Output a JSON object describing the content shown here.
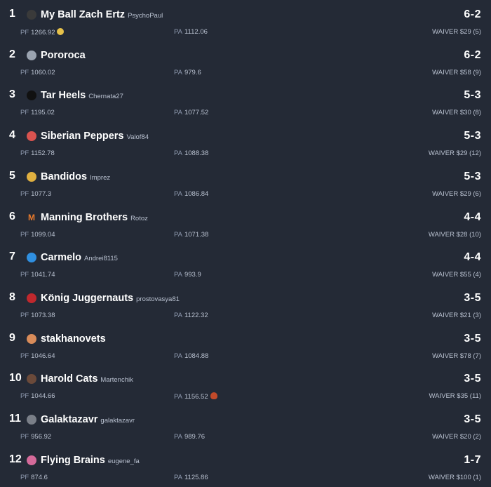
{
  "standings": [
    {
      "rank": "1",
      "team": "My Ball Zach Ertz",
      "owner": "PsychoPaul",
      "record": "6-2",
      "pf": "1266.92",
      "pa": "1112.06",
      "waiver": "WAIVER $29 (5)",
      "avatar_color": "#3a3a3a",
      "pf_emoji": "smiley-icon"
    },
    {
      "rank": "2",
      "team": "Pororoca",
      "owner": "",
      "record": "6-2",
      "pf": "1060.02",
      "pa": "979.6",
      "waiver": "WAIVER $58 (9)",
      "avatar_color": "#9aa3b0"
    },
    {
      "rank": "3",
      "team": "Tar Heels",
      "owner": "Chernata27",
      "record": "5-3",
      "pf": "1195.02",
      "pa": "1077.52",
      "waiver": "WAIVER $30 (8)",
      "avatar_color": "#111111"
    },
    {
      "rank": "4",
      "team": "Siberian Peppers",
      "owner": "Valof84",
      "record": "5-3",
      "pf": "1152.78",
      "pa": "1088.38",
      "waiver": "WAIVER $29 (12)",
      "avatar_color": "#d9534f"
    },
    {
      "rank": "5",
      "team": "Bandidos",
      "owner": "Imprez",
      "record": "5-3",
      "pf": "1077.3",
      "pa": "1086.84",
      "waiver": "WAIVER $29 (6)",
      "avatar_color": "#e0b040"
    },
    {
      "rank": "6",
      "team": "Manning Brothers",
      "owner": "Rotoz",
      "record": "4-4",
      "pf": "1099.04",
      "pa": "1071.38",
      "waiver": "WAIVER $28 (10)",
      "avatar_letter": "M"
    },
    {
      "rank": "7",
      "team": "Carmelo",
      "owner": "Andrei8115",
      "record": "4-4",
      "pf": "1041.74",
      "pa": "993.9",
      "waiver": "WAIVER $55 (4)",
      "avatar_color": "#2f8fe0"
    },
    {
      "rank": "8",
      "team": "König Juggernauts",
      "owner": "prostovasya81",
      "record": "3-5",
      "pf": "1073.38",
      "pa": "1122.32",
      "waiver": "WAIVER $21 (3)",
      "avatar_color": "#c0282d"
    },
    {
      "rank": "9",
      "team": "stakhanovets",
      "owner": "",
      "record": "3-5",
      "pf": "1046.64",
      "pa": "1084.88",
      "waiver": "WAIVER $78 (7)",
      "avatar_color": "#d98c5a"
    },
    {
      "rank": "10",
      "team": "Harold Cats",
      "owner": "Martenchik",
      "record": "3-5",
      "pf": "1044.66",
      "pa": "1156.52",
      "waiver": "WAIVER $35 (11)",
      "avatar_color": "#6b4a3a",
      "pa_emoji": "fire-icon"
    },
    {
      "rank": "11",
      "team": "Galaktazavr",
      "owner": "galaktazavr",
      "record": "3-5",
      "pf": "956.92",
      "pa": "989.76",
      "waiver": "WAIVER $20 (2)",
      "avatar_color": "#7a7f88"
    },
    {
      "rank": "12",
      "team": "Flying Brains",
      "owner": "eugene_fa",
      "record": "1-7",
      "pf": "874.6",
      "pa": "1125.86",
      "waiver": "WAIVER $100 (1)",
      "avatar_color": "#d46a9a"
    }
  ],
  "labels": {
    "pf": "PF",
    "pa": "PA"
  }
}
